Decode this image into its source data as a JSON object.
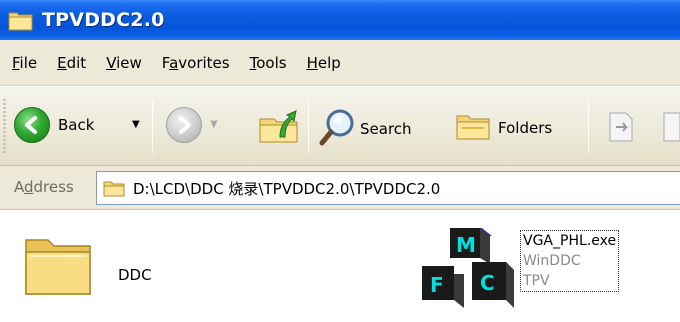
{
  "window": {
    "title": "TPVDDC2.0"
  },
  "menu": {
    "items": [
      {
        "pre": "",
        "ul": "F",
        "post": "ile"
      },
      {
        "pre": "",
        "ul": "E",
        "post": "dit"
      },
      {
        "pre": "",
        "ul": "V",
        "post": "iew"
      },
      {
        "pre": "F",
        "ul": "a",
        "post": "vorites"
      },
      {
        "pre": "",
        "ul": "T",
        "post": "ools"
      },
      {
        "pre": "",
        "ul": "H",
        "post": "elp"
      }
    ]
  },
  "toolbar": {
    "back_label": "Back",
    "search_label": "Search",
    "folders_label": "Folders"
  },
  "address": {
    "label_pre": "A",
    "label_ul": "d",
    "label_post": "dress",
    "path": "D:\\LCD\\DDC  烧录\\TPVDDC2.0\\TPVDDC2.0"
  },
  "files": [
    {
      "name": "DDC",
      "type": "folder"
    },
    {
      "name": "VGA_PHL.exe",
      "description": "WinDDC",
      "company": "TPV",
      "type": "exe",
      "icon_letters": [
        "M",
        "F",
        "C"
      ]
    }
  ],
  "colors": {
    "titlebar": "#0a5be0",
    "chrome": "#ece9d8",
    "folder": "#f5d77a",
    "exe_cube_top": "#2a3d9a",
    "exe_cube_face": "#1a1a1a",
    "exe_letters": "#00e0e0"
  }
}
